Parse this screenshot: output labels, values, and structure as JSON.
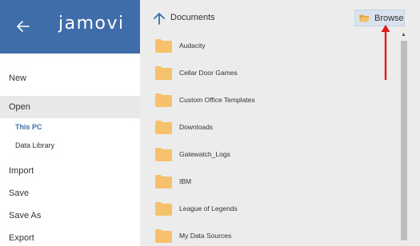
{
  "app": {
    "logo_text": "jamovi",
    "brand_color": "#3e6da9"
  },
  "sidebar": {
    "items": [
      {
        "label": "New"
      },
      {
        "label": "Open"
      },
      {
        "label": "Import"
      },
      {
        "label": "Save"
      },
      {
        "label": "Save As"
      },
      {
        "label": "Export"
      }
    ],
    "open_subitems": [
      {
        "label": "This PC",
        "active": true
      },
      {
        "label": "Data Library",
        "active": false
      }
    ]
  },
  "browser": {
    "path": "Documents",
    "browse_label": "Browse",
    "folders": [
      "Audacity",
      "Cellar Door Games",
      "Custom Office Templates",
      "Downloads",
      "Gatewatch_Logs",
      "IBM",
      "League of Legends",
      "My Data Sources"
    ],
    "folder_color": "#f5c26b"
  },
  "annotation": {
    "arrow_color": "#e21a1a"
  }
}
